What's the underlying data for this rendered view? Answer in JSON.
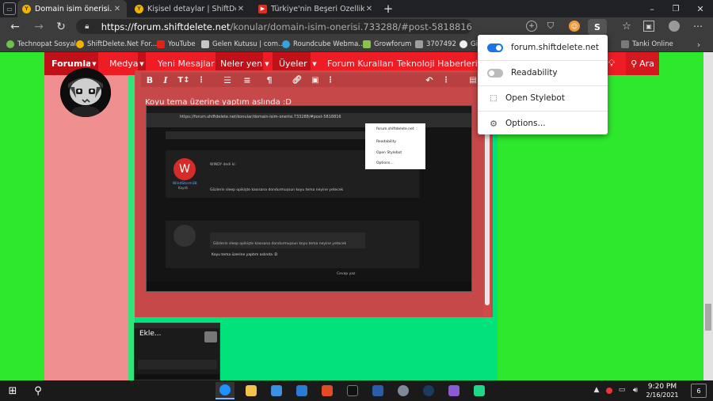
{
  "tabs": [
    {
      "label": "Domain isim önerisi. | ShiftDelete",
      "active": true,
      "favicon_color": "#f0b400"
    },
    {
      "label": "Kişisel detaylar | ShiftDelete.Net",
      "active": false,
      "favicon_color": "#f0b400"
    },
    {
      "label": "Türkiye'nin Beşeri Özellikleri (Yav",
      "active": false,
      "favicon_color": "#d93025"
    }
  ],
  "window_controls": {
    "minimize": "–",
    "maximize": "❐",
    "close": "✕"
  },
  "address": {
    "host": "https://forum.shiftdelete.net",
    "path": "/konular/domain-isim-onerisi.733288/#post-5818816"
  },
  "bookmarks": [
    "Technopat Sosyal",
    "ShiftDelete.Net For...",
    "YouTube",
    "Gelen Kutusu | com...",
    "Roundcube Webma...",
    "Growforum",
    "3707492",
    "Gi",
    "Tanki Online"
  ],
  "forum_nav": {
    "items": [
      "Forumlar",
      "Medya",
      "Yeni Mesajlar",
      "Neler yeni",
      "Üyeler",
      "Forum Kuralları",
      "Teknoloji Haberleri"
    ],
    "search": "Ara"
  },
  "editor": {
    "post_text": "Koyu tema üzerine yaptım aslında :D"
  },
  "popup": {
    "site": "forum.shiftdelete.net",
    "readability": "Readability",
    "open": "Open Stylebot",
    "options": "Options...",
    "site_enabled": true,
    "readability_enabled": false
  },
  "thumbnail": {
    "label": "Ekle..."
  },
  "embedded": {
    "url": "https://forum.shiftdelete.net/konular/domain-isim-onerisi.733288/#post-5818816",
    "username": "WindStorm38",
    "rank": "Kayıtlı",
    "user_title": "WINDY dedi ki:",
    "post1": "Gözlerin sleep opikişte kasısana dondurmuşsun koyu tema neyine yetecek",
    "reply_quote": "Gözlerin sleep opikişte kasısana dondurmuşsun koyu tema neyine yetecek",
    "reply_text": "Koyu tema üzerine yaptım aslında :D",
    "post_btn": "Cevap yaz",
    "popup_items": [
      "forum.shiftdelete.net",
      "Readability",
      "Open Stylebot",
      "Options..."
    ]
  },
  "clock": {
    "time": "9:20 PM",
    "date": "2/16/2021"
  },
  "notifications": "6",
  "colors": {
    "nav_red": "#ee1c24",
    "nav_dark": "#c01018",
    "green": "#2ee82e",
    "teal": "#02e27a",
    "editor": "#c64848",
    "toggle_on": "#1a73e8"
  }
}
